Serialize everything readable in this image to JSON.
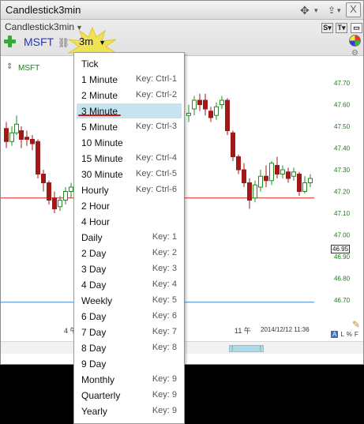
{
  "window": {
    "title": "Candlestick3min"
  },
  "titlebar": {
    "move_icon": "move-arrows-icon",
    "upload_icon": "upload-icon",
    "close_label": "X"
  },
  "toolbar": {
    "chart_name": "Candlestick3min",
    "symbol": "MSFT",
    "interval": "3m",
    "s_button": "S",
    "t_button": "T"
  },
  "chart": {
    "symbol": "MSFT",
    "price_labels": [
      "47.70",
      "47.60",
      "47.50",
      "47.40",
      "47.30",
      "47.20",
      "47.10",
      "47.00",
      "46.90",
      "46.80",
      "46.70"
    ],
    "current_price": "46.95",
    "x_label_a": "4 午",
    "x_label_b": "11 午",
    "date_label": "2014/12/12 11:36",
    "modes": [
      "A",
      "L",
      "%",
      "F"
    ],
    "red_line_price": 47.17,
    "blue_line_price": 46.69,
    "colors": {
      "up": "#1e8c1e",
      "down": "#a01818",
      "price_axis": "#1a7a1a",
      "red_line": "#e02020",
      "blue_line": "#3b87d6"
    }
  },
  "menu": {
    "items": [
      {
        "label": "Tick",
        "key": ""
      },
      {
        "label": "1 Minute",
        "key": "Key: Ctrl-1"
      },
      {
        "label": "2 Minute",
        "key": "Key: Ctrl-2"
      },
      {
        "label": "3 Minute",
        "key": "",
        "selected": true
      },
      {
        "label": "5 Minute",
        "key": "Key: Ctrl-3"
      },
      {
        "label": "10 Minute",
        "key": ""
      },
      {
        "label": "15 Minute",
        "key": "Key: Ctrl-4"
      },
      {
        "label": "30 Minute",
        "key": "Key: Ctrl-5"
      },
      {
        "label": "Hourly",
        "key": "Key: Ctrl-6"
      },
      {
        "label": "2 Hour",
        "key": ""
      },
      {
        "label": "4 Hour",
        "key": ""
      },
      {
        "label": "Daily",
        "key": "Key: 1"
      },
      {
        "label": "2 Day",
        "key": "Key: 2"
      },
      {
        "label": "3 Day",
        "key": "Key: 3"
      },
      {
        "label": "4 Day",
        "key": "Key: 4"
      },
      {
        "label": "Weekly",
        "key": "Key: 5"
      },
      {
        "label": "6 Day",
        "key": "Key: 6"
      },
      {
        "label": "7 Day",
        "key": "Key: 7"
      },
      {
        "label": "8 Day",
        "key": "Key: 8"
      },
      {
        "label": "9 Day",
        "key": ""
      },
      {
        "label": "Monthly",
        "key": "Key: 9"
      },
      {
        "label": "Quarterly",
        "key": "Key: 9"
      },
      {
        "label": "Yearly",
        "key": "Key: 9"
      }
    ]
  }
}
